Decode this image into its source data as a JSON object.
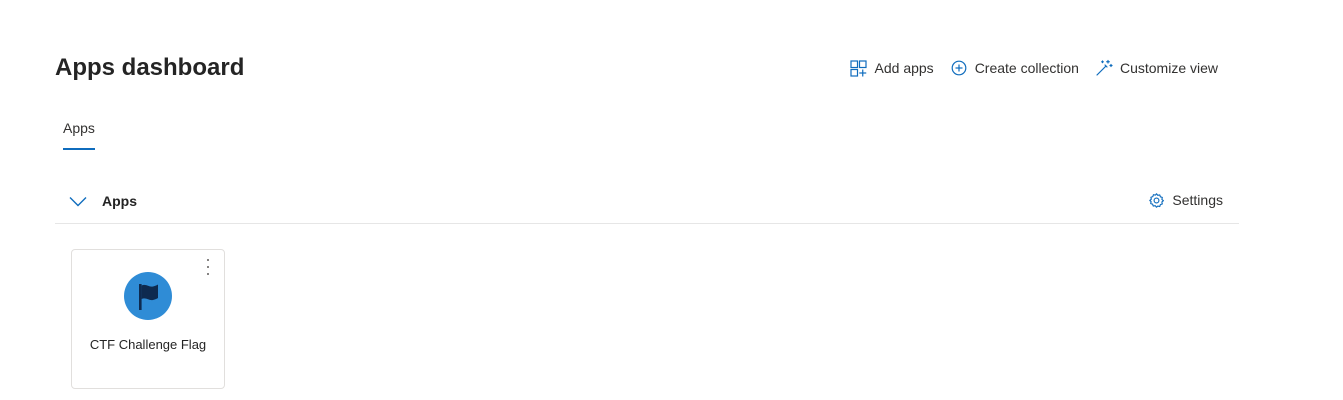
{
  "header": {
    "title": "Apps dashboard"
  },
  "commands": {
    "add_apps": {
      "label": "Add apps",
      "icon": "add-apps-grid-icon"
    },
    "create_collection": {
      "label": "Create collection",
      "icon": "plus-circle-icon"
    },
    "customize_view": {
      "label": "Customize view",
      "icon": "magic-wand-icon"
    }
  },
  "tabs": [
    {
      "label": "Apps",
      "selected": true
    }
  ],
  "section": {
    "title": "Apps",
    "expanded": true,
    "toggle_icon": "chevron-down-icon",
    "settings_label": "Settings",
    "settings_icon": "gear-icon"
  },
  "apps": [
    {
      "label": "CTF Challenge Flag",
      "icon": "flag-icon",
      "menu_icon": "more-vertical-icon"
    }
  ],
  "colors": {
    "accent": "#0f6cbd",
    "icon_blue": "#2f8cd6",
    "flag_navy": "#0e2a4f",
    "divider": "#e6e6e6",
    "tile_border": "#e1dfdd"
  }
}
